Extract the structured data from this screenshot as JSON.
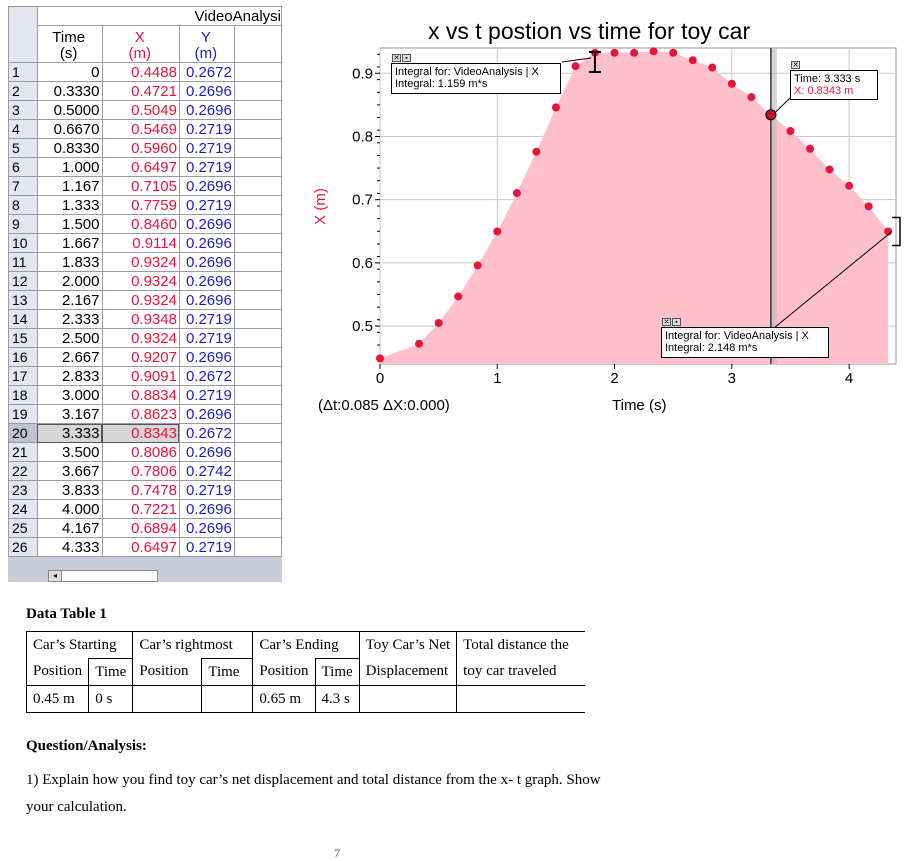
{
  "table": {
    "group_header": "VideoAnalysi",
    "columns": [
      {
        "name": "Time",
        "unit": "(s)"
      },
      {
        "name": "X",
        "unit": "(m)"
      },
      {
        "name": "Y",
        "unit": "(m)"
      }
    ],
    "rows": [
      {
        "n": "1",
        "t": "0",
        "x": "0.4488",
        "y": "0.2672"
      },
      {
        "n": "2",
        "t": "0.3330",
        "x": "0.4721",
        "y": "0.2696"
      },
      {
        "n": "3",
        "t": "0.5000",
        "x": "0.5049",
        "y": "0.2696"
      },
      {
        "n": "4",
        "t": "0.6670",
        "x": "0.5469",
        "y": "0.2719"
      },
      {
        "n": "5",
        "t": "0.8330",
        "x": "0.5960",
        "y": "0.2719"
      },
      {
        "n": "6",
        "t": "1.000",
        "x": "0.6497",
        "y": "0.2719"
      },
      {
        "n": "7",
        "t": "1.167",
        "x": "0.7105",
        "y": "0.2696"
      },
      {
        "n": "8",
        "t": "1.333",
        "x": "0.7759",
        "y": "0.2719"
      },
      {
        "n": "9",
        "t": "1.500",
        "x": "0.8460",
        "y": "0.2696"
      },
      {
        "n": "10",
        "t": "1.667",
        "x": "0.9114",
        "y": "0.2696"
      },
      {
        "n": "11",
        "t": "1.833",
        "x": "0.9324",
        "y": "0.2696"
      },
      {
        "n": "12",
        "t": "2.000",
        "x": "0.9324",
        "y": "0.2696"
      },
      {
        "n": "13",
        "t": "2.167",
        "x": "0.9324",
        "y": "0.2696"
      },
      {
        "n": "14",
        "t": "2.333",
        "x": "0.9348",
        "y": "0.2719"
      },
      {
        "n": "15",
        "t": "2.500",
        "x": "0.9324",
        "y": "0.2719"
      },
      {
        "n": "16",
        "t": "2.667",
        "x": "0.9207",
        "y": "0.2696"
      },
      {
        "n": "17",
        "t": "2.833",
        "x": "0.9091",
        "y": "0.2672"
      },
      {
        "n": "18",
        "t": "3.000",
        "x": "0.8834",
        "y": "0.2719"
      },
      {
        "n": "19",
        "t": "3.167",
        "x": "0.8623",
        "y": "0.2696"
      },
      {
        "n": "20",
        "t": "3.333",
        "x": "0.8343",
        "y": "0.2672"
      },
      {
        "n": "21",
        "t": "3.500",
        "x": "0.8086",
        "y": "0.2696"
      },
      {
        "n": "22",
        "t": "3.667",
        "x": "0.7806",
        "y": "0.2742"
      },
      {
        "n": "23",
        "t": "3.833",
        "x": "0.7478",
        "y": "0.2719"
      },
      {
        "n": "24",
        "t": "4.000",
        "x": "0.7221",
        "y": "0.2696"
      },
      {
        "n": "25",
        "t": "4.167",
        "x": "0.6894",
        "y": "0.2696"
      },
      {
        "n": "26",
        "t": "4.333",
        "x": "0.6497",
        "y": "0.2719"
      }
    ],
    "selected_row": "20"
  },
  "graph": {
    "title": "x vs t postion vs time for toy car",
    "ylabel": "X (m)",
    "xlabel": "Time (s)",
    "delta_readout": "(Δt:0.085 ΔX:0.000)",
    "integral1_line1": "Integral for: VideoAnalysis | X",
    "integral1_line2": "Integral: 1.159 m*s",
    "integral2_line1": "Integral for: VideoAnalysis | X",
    "integral2_line2": "Integral: 2.148 m*s",
    "examine_time": "Time: 3.333 s",
    "examine_x": "X: 0.8343 m",
    "colors": {
      "point": "#e8143c",
      "fill": "#ffc0cb",
      "y_color": "#1e1ec8"
    }
  },
  "chart_data": {
    "type": "scatter",
    "title": "x vs t postion vs time for toy car",
    "xlabel": "Time (s)",
    "ylabel": "X (m)",
    "xlim": [
      0,
      4.4
    ],
    "ylim": [
      0.44,
      0.94
    ],
    "xticks": [
      0,
      1,
      2,
      3,
      4
    ],
    "yticks": [
      0.5,
      0.6,
      0.7,
      0.8,
      0.9
    ],
    "x": [
      0,
      0.333,
      0.5,
      0.667,
      0.833,
      1.0,
      1.167,
      1.333,
      1.5,
      1.667,
      1.833,
      2.0,
      2.167,
      2.333,
      2.5,
      2.667,
      2.833,
      3.0,
      3.167,
      3.333,
      3.5,
      3.667,
      3.833,
      4.0,
      4.167,
      4.333
    ],
    "y": [
      0.4488,
      0.4721,
      0.5049,
      0.5469,
      0.596,
      0.6497,
      0.7105,
      0.7759,
      0.846,
      0.9114,
      0.9324,
      0.9324,
      0.9324,
      0.9348,
      0.9324,
      0.9207,
      0.9091,
      0.8834,
      0.8623,
      0.8343,
      0.8086,
      0.7806,
      0.7478,
      0.7221,
      0.6894,
      0.6497
    ],
    "examine_time": 3.333,
    "grid": true,
    "filled": true
  },
  "doc": {
    "table_title": "Data Table 1",
    "head1": [
      "Car’s Starting",
      "Car’s rightmost",
      "Car’s Ending",
      "Toy Car’s Net",
      "Total distance the"
    ],
    "head2": [
      "Position",
      "Time",
      "Position",
      "Time",
      "Position",
      "Time",
      "Displacement",
      "toy car traveled"
    ],
    "vals": [
      "0.45 m",
      "0 s",
      "",
      "",
      "0.65 m",
      "4.3 s",
      "",
      ""
    ],
    "qa_title": "Question/Analysis:",
    "q1_line1": "1) Explain how you find toy car’s net displacement and total distance from the x- t graph. Show",
    "q1_line2": "your calculation.",
    "page_number": "7"
  }
}
